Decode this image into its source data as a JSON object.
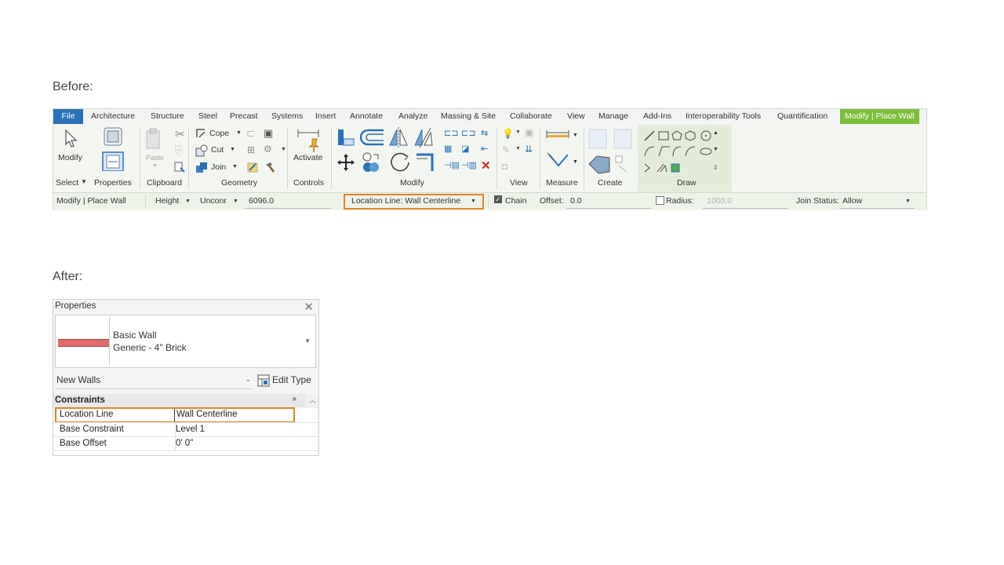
{
  "captions": {
    "before": "Before:",
    "after": "After:"
  },
  "ribbon": {
    "tabs": [
      "File",
      "Architecture",
      "Structure",
      "Steel",
      "Precast",
      "Systems",
      "Insert",
      "Annotate",
      "Analyze",
      "Massing & Site",
      "Collaborate",
      "View",
      "Manage",
      "Add-Ins",
      "Interoperability Tools",
      "Quantification",
      "Modify | Place Wall"
    ],
    "buttons": {
      "modify": "Modify",
      "paste": "Paste",
      "cope": "Cope",
      "cut": "Cut",
      "join": "Join",
      "activate": "Activate"
    },
    "panels": {
      "select": "Select",
      "properties": "Properties",
      "clipboard": "Clipboard",
      "geometry": "Geometry",
      "controls": "Controls",
      "modify": "Modify",
      "view": "View",
      "measure": "Measure",
      "create": "Create",
      "draw": "Draw"
    },
    "accent_color": "#7bbf3a",
    "file_tab_color": "#2a72b8"
  },
  "options_bar": {
    "context": "Modify | Place Wall",
    "height_label": "Height",
    "height_constraint": "Unconr",
    "height_value": "6096.0",
    "location_line": "Location Line: Wall Centerline",
    "chain_label": "Chain",
    "chain_checked": true,
    "offset_label": "Offset:",
    "offset_value": "0.0",
    "radius_label": "Radius:",
    "radius_value": "1000.0",
    "join_status_label": "Join Status:",
    "join_status_value": "Allow",
    "highlight_color": "#e8821e"
  },
  "properties": {
    "title": "Properties",
    "type_family": "Basic Wall",
    "type_name": "Generic - 4\" Brick",
    "instance_filter": "New Walls",
    "edit_type": "Edit Type",
    "group": "Constraints",
    "rows": [
      {
        "label": "Location Line",
        "value": "Wall Centerline"
      },
      {
        "label": "Base Constraint",
        "value": "Level 1"
      },
      {
        "label": "Base Offset",
        "value": "0'  0\""
      }
    ],
    "swatch_color": "#e06b6b"
  }
}
